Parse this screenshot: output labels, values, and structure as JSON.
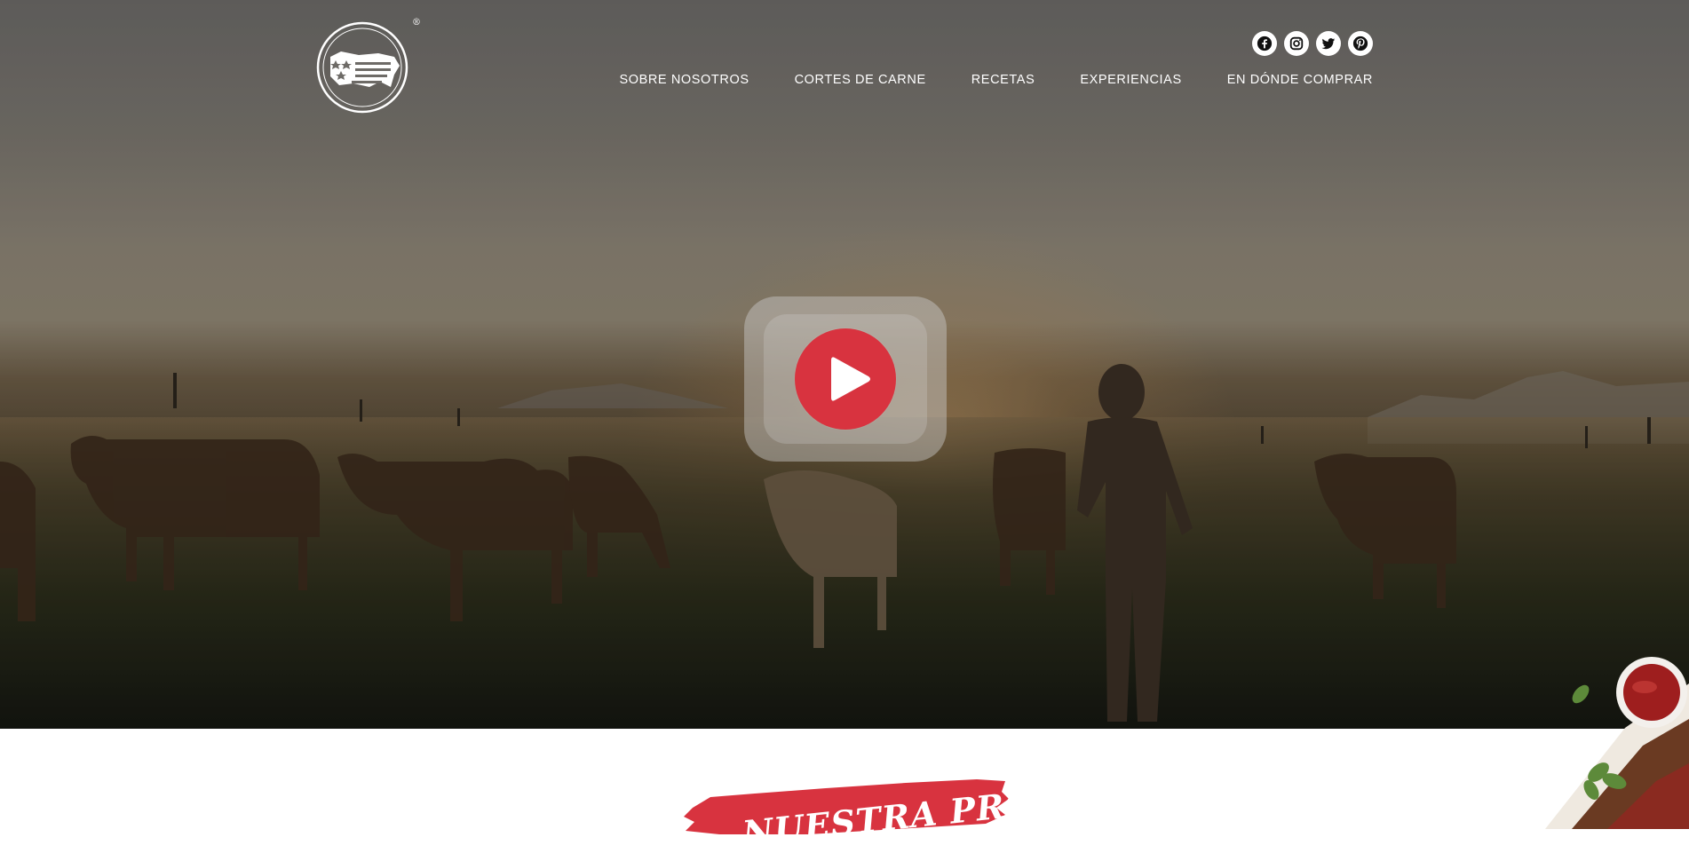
{
  "brand": {
    "logo_text_top": "U.S.MEAT",
    "logo_text_bottom": "EXPORT FEDERATION",
    "registered_mark": "®"
  },
  "social": [
    {
      "icon": "facebook-icon"
    },
    {
      "icon": "instagram-icon"
    },
    {
      "icon": "twitter-icon"
    },
    {
      "icon": "pinterest-icon"
    }
  ],
  "nav": {
    "items": [
      "SOBRE NOSOTROS",
      "CORTES DE CARNE",
      "RECETAS",
      "EXPERIENCIAS",
      "EN DÓNDE COMPRAR"
    ]
  },
  "hero": {
    "play_icon": "play-icon"
  },
  "section": {
    "heading": "NUESTRA PROMESA"
  },
  "colors": {
    "accent_red": "#d8333f",
    "nav_text": "#ffffff"
  }
}
